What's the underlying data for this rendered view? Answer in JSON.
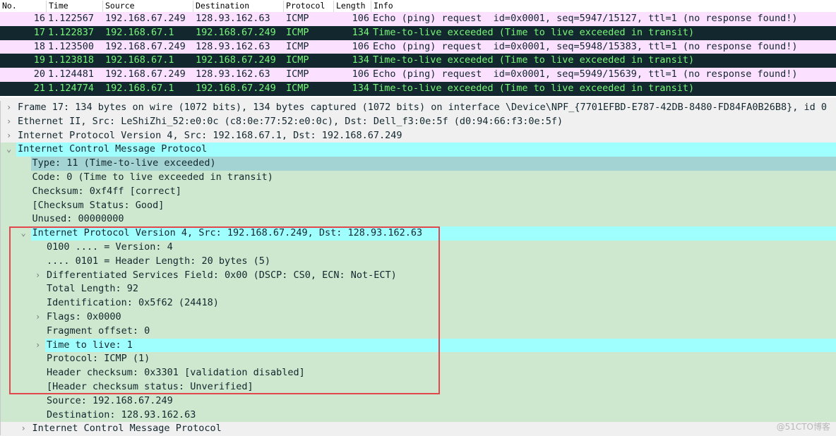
{
  "packet_list": {
    "columns": [
      "No.",
      "Time",
      "Source",
      "Destination",
      "Protocol",
      "Length",
      "Info"
    ],
    "rows": [
      {
        "no": "16",
        "time": "1.122567",
        "src": "192.168.67.249",
        "dst": "128.93.162.63",
        "proto": "ICMP",
        "len": "106",
        "info": "Echo (ping) request  id=0x0001, seq=5947/15127, ttl=1 (no response found!)",
        "kind": "req"
      },
      {
        "no": "17",
        "time": "1.122837",
        "src": "192.168.67.1",
        "dst": "192.168.67.249",
        "proto": "ICMP",
        "len": "134",
        "info": "Time-to-live exceeded (Time to live exceeded in transit)",
        "kind": "ttl"
      },
      {
        "no": "18",
        "time": "1.123500",
        "src": "192.168.67.249",
        "dst": "128.93.162.63",
        "proto": "ICMP",
        "len": "106",
        "info": "Echo (ping) request  id=0x0001, seq=5948/15383, ttl=1 (no response found!)",
        "kind": "req"
      },
      {
        "no": "19",
        "time": "1.123818",
        "src": "192.168.67.1",
        "dst": "192.168.67.249",
        "proto": "ICMP",
        "len": "134",
        "info": "Time-to-live exceeded (Time to live exceeded in transit)",
        "kind": "ttl"
      },
      {
        "no": "20",
        "time": "1.124481",
        "src": "192.168.67.249",
        "dst": "128.93.162.63",
        "proto": "ICMP",
        "len": "106",
        "info": "Echo (ping) request  id=0x0001, seq=5949/15639, ttl=1 (no response found!)",
        "kind": "req"
      },
      {
        "no": "21",
        "time": "1.124774",
        "src": "192.168.67.1",
        "dst": "192.168.67.249",
        "proto": "ICMP",
        "len": "134",
        "info": "Time-to-live exceeded (Time to live exceeded in transit)",
        "kind": "ttl"
      }
    ]
  },
  "details": [
    {
      "level": 0,
      "exp": "collapsed",
      "bg": "g",
      "text": "Frame 17: 134 bytes on wire (1072 bits), 134 bytes captured (1072 bits) on interface \\Device\\NPF_{7701EFBD-E787-42DB-8480-FD84FA0B26B8}, id 0"
    },
    {
      "level": 0,
      "exp": "collapsed",
      "bg": "g",
      "text": "Ethernet II, Src: LeShiZhi_52:e0:0c (c8:0e:77:52:e0:0c), Dst: Dell_f3:0e:5f (d0:94:66:f3:0e:5f)"
    },
    {
      "level": 0,
      "exp": "collapsed",
      "bg": "g",
      "text": "Internet Protocol Version 4, Src: 192.168.67.1, Dst: 192.168.67.249"
    },
    {
      "level": 0,
      "exp": "expanded",
      "bg": "gr",
      "hl": "cy",
      "text": "Internet Control Message Protocol"
    },
    {
      "level": 1,
      "exp": "",
      "bg": "gr",
      "hl": "sel",
      "text": "Type: 11 (Time-to-live exceeded)"
    },
    {
      "level": 1,
      "exp": "",
      "bg": "gr",
      "text": "Code: 0 (Time to live exceeded in transit)"
    },
    {
      "level": 1,
      "exp": "",
      "bg": "gr",
      "text": "Checksum: 0xf4ff [correct]"
    },
    {
      "level": 1,
      "exp": "",
      "bg": "gr",
      "text": "[Checksum Status: Good]"
    },
    {
      "level": 1,
      "exp": "",
      "bg": "gr",
      "text": "Unused: 00000000"
    },
    {
      "level": 1,
      "exp": "expanded",
      "bg": "gr",
      "hl": "cy",
      "text": "Internet Protocol Version 4, Src: 192.168.67.249, Dst: 128.93.162.63"
    },
    {
      "level": 2,
      "exp": "",
      "bg": "gr",
      "text": "0100 .... = Version: 4"
    },
    {
      "level": 2,
      "exp": "",
      "bg": "gr",
      "text": ".... 0101 = Header Length: 20 bytes (5)"
    },
    {
      "level": 2,
      "exp": "collapsed",
      "bg": "gr",
      "text": "Differentiated Services Field: 0x00 (DSCP: CS0, ECN: Not-ECT)"
    },
    {
      "level": 2,
      "exp": "",
      "bg": "gr",
      "text": "Total Length: 92"
    },
    {
      "level": 2,
      "exp": "",
      "bg": "gr",
      "text": "Identification: 0x5f62 (24418)"
    },
    {
      "level": 2,
      "exp": "collapsed",
      "bg": "gr",
      "text": "Flags: 0x0000"
    },
    {
      "level": 2,
      "exp": "",
      "bg": "gr",
      "text": "Fragment offset: 0"
    },
    {
      "level": 2,
      "exp": "collapsed",
      "bg": "gr",
      "hl": "cy",
      "text": "Time to live: 1"
    },
    {
      "level": 2,
      "exp": "",
      "bg": "gr",
      "text": "Protocol: ICMP (1)"
    },
    {
      "level": 2,
      "exp": "",
      "bg": "gr",
      "text": "Header checksum: 0x3301 [validation disabled]"
    },
    {
      "level": 2,
      "exp": "",
      "bg": "gr",
      "text": "[Header checksum status: Unverified]"
    },
    {
      "level": 2,
      "exp": "",
      "bg": "gr",
      "text": "Source: 192.168.67.249"
    },
    {
      "level": 2,
      "exp": "",
      "bg": "gr",
      "text": "Destination: 128.93.162.63"
    },
    {
      "level": 1,
      "exp": "collapsed",
      "bg": "g",
      "text": "Internet Control Message Protocol"
    }
  ],
  "watermark": "@51CTO博客",
  "colors": {
    "request_row": "#fce0ff",
    "ttl_row_bg": "#12272e",
    "ttl_row_fg": "#78f878",
    "detail_green": "#cde8cf",
    "highlight_cyan": "#9fffff",
    "annotation_box": "#e2474b"
  }
}
